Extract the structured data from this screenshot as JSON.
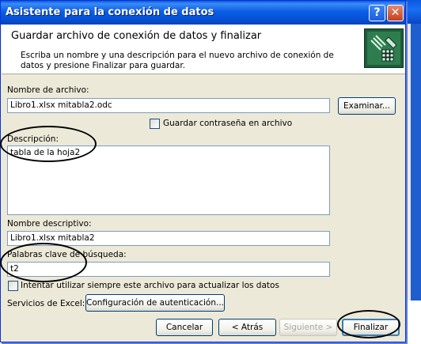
{
  "window": {
    "title": "Asistente para la conexión de datos",
    "help_glyph": "?",
    "close_glyph": "✕"
  },
  "header": {
    "title": "Guardar archivo de conexión de datos y finalizar",
    "description": "Escriba un nombre y una descripción para el nuevo archivo de conexión de datos y presione Finalizar para guardar.",
    "icon": "data-connection-wizard-icon"
  },
  "form": {
    "filename_label": "Nombre de archivo:",
    "filename_value": "Libro1.xlsx mitabla2.odc",
    "browse_button": "Examinar...",
    "save_password_label": "Guardar contraseña en archivo",
    "save_password_checked": false,
    "description_label": "Descripción:",
    "description_value": "tabla de la hoja2",
    "friendly_name_label": "Nombre descriptivo:",
    "friendly_name_value": "Libro1.xlsx mitabla2",
    "keywords_label": "Palabras clave de búsqueda:",
    "keywords_value": "t2",
    "always_use_label": "Intentar utilizar siempre este archivo para actualizar los datos",
    "always_use_checked": false,
    "excel_services_label": "Servicios de Excel:",
    "auth_button": "Configuración de autenticación..."
  },
  "footer": {
    "cancel_button": "Cancelar",
    "back_button": "< Atrás",
    "next_button": "Siguiente >",
    "finish_button": "Finalizar"
  },
  "colors": {
    "titlebar": "#0a58df",
    "dialog_bg": "#ece9d8",
    "input_border": "#7f9db9"
  }
}
